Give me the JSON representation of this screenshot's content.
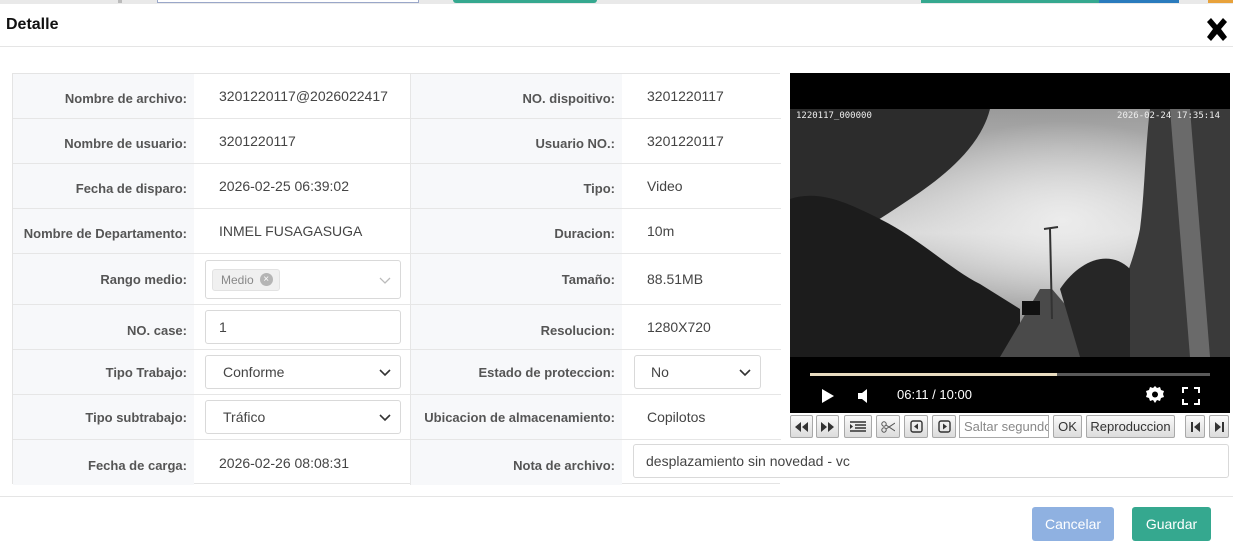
{
  "dialog": {
    "title": "Detalle"
  },
  "fields": {
    "nombre_archivo": {
      "label": "Nombre de archivo:",
      "value": "3201220117@2026022417"
    },
    "no_dispositivo": {
      "label": "NO. dispoitivo:",
      "value": "3201220117"
    },
    "nombre_usuario": {
      "label": "Nombre de usuario:",
      "value": "3201220117"
    },
    "usuario_no": {
      "label": "Usuario NO.:",
      "value": "3201220117"
    },
    "fecha_disparo": {
      "label": "Fecha de disparo:",
      "value": "2026-02-25 06:39:02"
    },
    "tipo": {
      "label": "Tipo:",
      "value": "Video"
    },
    "departamento": {
      "label": "Nombre de Departamento:",
      "value": "INMEL FUSAGASUGA"
    },
    "duracion": {
      "label": "Duracion:",
      "value": "10m"
    },
    "rango_medio": {
      "label": "Rango medio:",
      "tag": "Medio"
    },
    "tamano": {
      "label": "Tamaño:",
      "value": "88.51MB"
    },
    "no_case": {
      "label": "NO. case:",
      "value": "1"
    },
    "resolucion": {
      "label": "Resolucion:",
      "value": "1280X720"
    },
    "tipo_trabajo": {
      "label": "Tipo Trabajo:",
      "value": "Conforme"
    },
    "estado_proteccion": {
      "label": "Estado de proteccion:",
      "value": "No"
    },
    "tipo_subtrabajo": {
      "label": "Tipo subtrabajo:",
      "value": "Tráfico"
    },
    "ubicacion": {
      "label": "Ubicacion de almacenamiento:",
      "value": "Copilotos"
    },
    "fecha_carga": {
      "label": "Fecha de carga:",
      "value": "2026-02-26 08:08:31"
    },
    "nota_archivo": {
      "label": "Nota de archivo:",
      "value": "desplazamiento sin novedad - vc"
    }
  },
  "video": {
    "osd_left": "1220117_000000",
    "osd_right": "2026-02-24 17:35:14",
    "time": "06:11 / 10:00",
    "progress_fraction": 0.6183
  },
  "player_toolbar": {
    "skip_placeholder": "Saltar segundos",
    "ok_label": "OK",
    "play_label": "Reproduccion"
  },
  "footer": {
    "cancel_label": "Cancelar",
    "save_label": "Guardar"
  },
  "colors": {
    "accent": "#35a88f",
    "cancel": "#8fb1e1"
  }
}
